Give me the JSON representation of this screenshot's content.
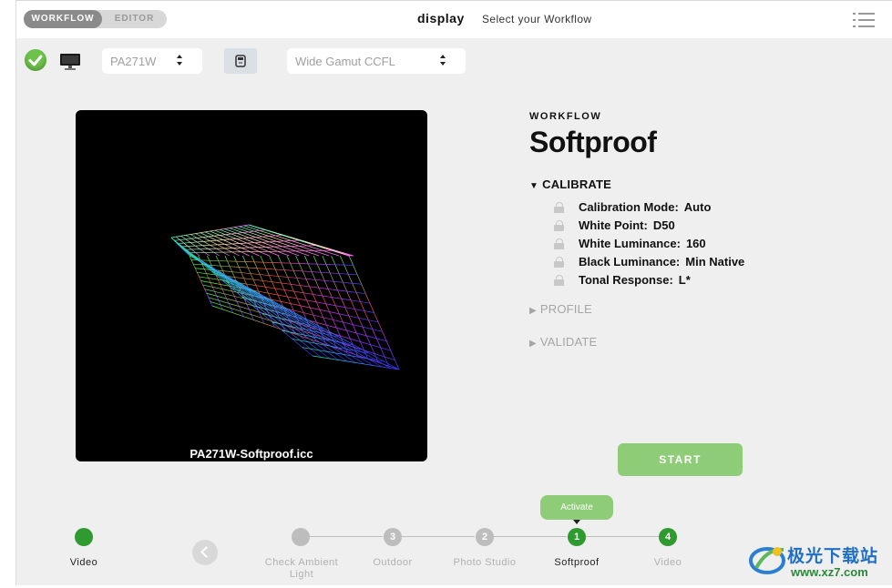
{
  "topbar": {
    "modes": [
      "WORKFLOW",
      "EDITOR"
    ],
    "title": "display",
    "subtitle": "Select your Workflow"
  },
  "toolbar": {
    "display_select": "PA271W",
    "technology_select": "Wide Gamut CCFL"
  },
  "preview": {
    "caption": "PA271W-Softproof.icc"
  },
  "workflow": {
    "label": "WORKFLOW",
    "title": "Softproof",
    "sections": {
      "calibrate": "CALIBRATE",
      "profile": "PROFILE",
      "validate": "VALIDATE"
    },
    "settings": [
      {
        "name": "Calibration Mode:",
        "value": "Auto"
      },
      {
        "name": "White Point:",
        "value": "D50"
      },
      {
        "name": "White Luminance:",
        "value": "160"
      },
      {
        "name": "Black Luminance:",
        "value": "Min Native"
      },
      {
        "name": "Tonal Response:",
        "value": "L*"
      }
    ],
    "start_label": "START"
  },
  "steps": {
    "tooltip": "Activate",
    "items": [
      {
        "label": "Video",
        "number": ""
      },
      {
        "label": "Check Ambient Light",
        "number": ""
      },
      {
        "label": "Outdoor",
        "number": "3"
      },
      {
        "label": "Photo Studio",
        "number": "2"
      },
      {
        "label": "Softproof",
        "number": "1"
      },
      {
        "label": "Video",
        "number": "4"
      }
    ]
  },
  "watermark": {
    "name": "极光下载站",
    "url": "www.xz7.com"
  },
  "colors": {
    "accent_green": "#8fcc78",
    "step_green": "#2f9a2f",
    "check_green": "#6cc24a"
  }
}
